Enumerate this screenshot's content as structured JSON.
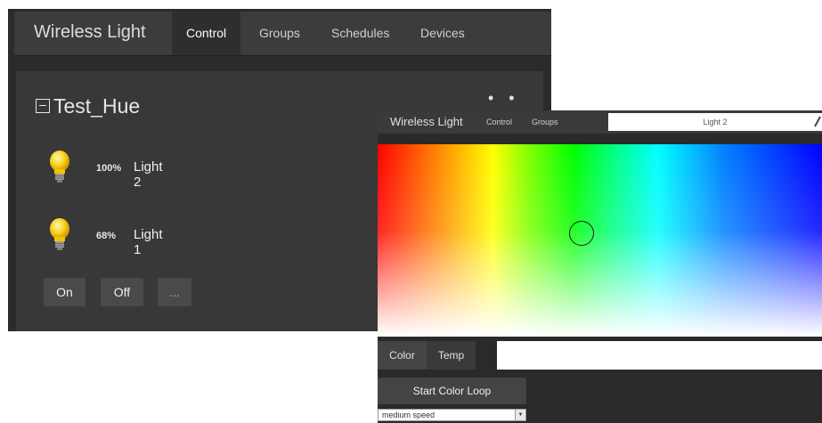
{
  "main_window": {
    "brand": "Wireless Light",
    "nav": [
      {
        "label": "Control",
        "active": true
      },
      {
        "label": "Groups",
        "active": false
      },
      {
        "label": "Schedules",
        "active": false
      },
      {
        "label": "Devices",
        "active": false
      }
    ],
    "group": {
      "title": "Test_Hue",
      "menu_dots": "• •",
      "lights": [
        {
          "name": "Light 2",
          "brightness": "100%",
          "icon": "lightbulb-icon"
        },
        {
          "name": "Light 1",
          "brightness": "68%",
          "icon": "lightbulb-icon"
        }
      ],
      "buttons": {
        "on": "On",
        "off": "Off",
        "more": "..."
      }
    }
  },
  "detail_window": {
    "brand": "Wireless Light",
    "nav": [
      "Control",
      "Groups"
    ],
    "light_name": "Light 2",
    "picker_selected_color": "#a8f0a0",
    "tabs": [
      {
        "label": "Color",
        "active": true
      },
      {
        "label": "Temp",
        "active": false
      }
    ],
    "color_loop_button": "Start Color Loop",
    "speed_select": {
      "selected": "medium speed"
    }
  },
  "colors": {
    "dark_bg": "#2b2b2b",
    "panel": "#383838",
    "navbar": "#3c3c3c",
    "button": "#4a4a4a",
    "bulb_yellow": "#f7d21a"
  }
}
